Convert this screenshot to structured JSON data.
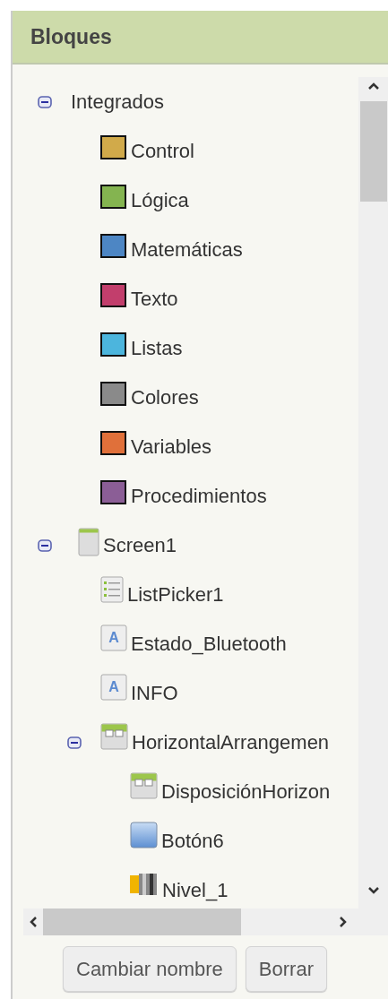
{
  "panel": {
    "title": "Bloques"
  },
  "tree": [
    {
      "label": "Integrados",
      "kind": "category",
      "expanded": true,
      "children": [
        {
          "label": "Control",
          "kind": "block",
          "color": "#d1aa4a"
        },
        {
          "label": "Lógica",
          "kind": "block",
          "color": "#84b450"
        },
        {
          "label": "Matemáticas",
          "kind": "block",
          "color": "#4d86c4"
        },
        {
          "label": "Texto",
          "kind": "block",
          "color": "#c23e6c"
        },
        {
          "label": "Listas",
          "kind": "block",
          "color": "#4cb5dd"
        },
        {
          "label": "Colores",
          "kind": "block",
          "color": "#8a8a8a"
        },
        {
          "label": "Variables",
          "kind": "block",
          "color": "#e0703a"
        },
        {
          "label": "Procedimientos",
          "kind": "block",
          "color": "#8b5e96"
        }
      ]
    },
    {
      "label": "Screen1",
      "kind": "screen",
      "expanded": true,
      "children": [
        {
          "label": "ListPicker1",
          "kind": "listpicker"
        },
        {
          "label": "Estado_Bluetooth",
          "kind": "label",
          "glyph": "A"
        },
        {
          "label": "INFO",
          "kind": "label",
          "glyph": "A"
        },
        {
          "label": "HorizontalArrangemen",
          "kind": "arrangement",
          "expanded": true,
          "children": [
            {
              "label": "DisposiciónHorizon",
              "kind": "arrangement"
            },
            {
              "label": "Botón6",
              "kind": "button"
            },
            {
              "label": "Nivel_1",
              "kind": "slider"
            }
          ]
        }
      ]
    }
  ],
  "buttons": [
    "Cambiar nombre",
    "Borrar"
  ]
}
